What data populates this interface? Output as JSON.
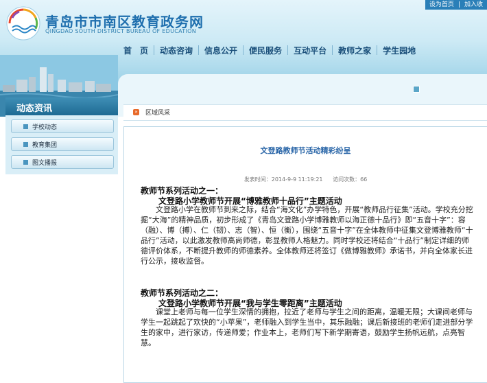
{
  "header": {
    "top_links": [
      "设为首页",
      "加入收"
    ],
    "title": "青岛市市南区教育政务网",
    "subtitle": "QINGDAO SOUTH DISTRICT BUREAU OF EDUCATION"
  },
  "nav": [
    "首　页",
    "动态咨询",
    "信息公开",
    "便民服务",
    "互动平台",
    "教师之家",
    "学生园地"
  ],
  "sidebar": {
    "title": "动态资讯",
    "items": [
      "学校动态",
      "教育集团",
      "图文播报"
    ]
  },
  "breadcrumb": "区域风采",
  "article": {
    "title": "文登路教师节活动精彩纷呈",
    "published_label": "发表时间：2014-9-9 11:19:21",
    "views_label": "访问次数：66",
    "section1_heading": "教师节系列活动之一：",
    "section1_subheading": "文登路小学教师节开展“博雅教师十品行”主题活动",
    "section1_body": "文登路小学在教师节到来之际，结合“海文化”办学特色，开展“教师品行征集”活动。学校充分挖掘“大海”的精神品质，初步形成了《青岛文登路小学博雅教师以海正德十品行》即“五音十字”：容（融）、博（搏）、仁（韧）、志（智）、恒（衡），围绕“五音十字”在全体教师中征集文登博雅教师“十品行”活动，以此激发教师高尚师德，彰显教师人格魅力。同时学校还将结合“十品行”制定详细的师德评价体系，不断提升教师的师德素养。全体教师还将签订《做博雅教师》承诺书，并向全体家长进行公示，接收监督。",
    "section2_heading": "教师节系列活动之二：",
    "section2_subheading": "文登路小学教师节开展“我与学生零距离”主题活动",
    "section2_body": "课堂上老师与每一位学生深情的拥抱，拉近了老师与学生之间的距离，温暖无限；大课间老师与学生一起跳起了欢快的“小苹果”，老师融入到学生当中，其乐融融；课后新接班的老师们走进部分学生的家中，进行家访，传递师爱；作业本上，老师们写下新学期寄语，鼓励学生扬帆远航，点亮智慧。"
  },
  "colors": {
    "brand": "#1f6fae",
    "title_link": "#2a66a8",
    "accent_orange": "#e86a2a"
  }
}
